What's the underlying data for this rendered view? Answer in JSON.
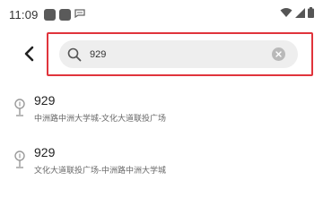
{
  "status_bar": {
    "time": "11:09",
    "notification_icons": [
      "app-notification-icon",
      "app-notification-icon",
      "message-notification-icon"
    ],
    "right_icons": [
      "wifi-icon",
      "signal-icon",
      "battery-icon"
    ]
  },
  "search": {
    "query": "929",
    "placeholder": ""
  },
  "results": [
    {
      "title": "929",
      "subtitle": "中洲路中洲大学城-文化大道联投广场"
    },
    {
      "title": "929",
      "subtitle": "文化大道联投广场-中洲路中洲大学城"
    }
  ],
  "colors": {
    "highlight_border": "#e0343c",
    "search_background": "#eeeeee"
  }
}
